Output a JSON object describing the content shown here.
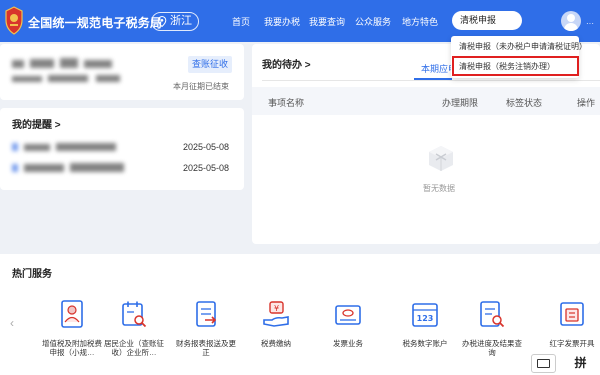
{
  "header": {
    "site_title": "全国统一规范电子税务局",
    "region": "浙江",
    "nav": [
      "首页",
      "我要办税",
      "我要查询",
      "公众服务",
      "地方特色"
    ],
    "search_value": "清税申报",
    "more": "···"
  },
  "search_dropdown": {
    "items": [
      "清税申报（未办税户申请清税证明）",
      "清税申报（税务注销办理）"
    ]
  },
  "account_card": {
    "button": "查账征收",
    "status": "本月征期已结束"
  },
  "reminders": {
    "title": "我的提醒 >",
    "items": [
      {
        "date": "2025-05-08"
      },
      {
        "date": "2025-05-08"
      }
    ]
  },
  "todo": {
    "title": "我的待办 >",
    "tab": "本期应申",
    "columns": [
      "事项名称",
      "办理期限",
      "标签状态",
      "操作"
    ],
    "empty_text": "暂无数据"
  },
  "hot_services": {
    "title": "热门服务",
    "items": [
      {
        "label": "增值税及附加税费申报（小规…",
        "icon": "person-document-icon"
      },
      {
        "label": "居民企业（查账征收）企业所…",
        "icon": "calendar-search-icon"
      },
      {
        "label": "财务报表报送及更正",
        "icon": "report-icon"
      },
      {
        "label": "税费缴纳",
        "icon": "hand-coin-icon"
      },
      {
        "label": "发票业务",
        "icon": "invoice-icon"
      },
      {
        "label": "税务数字账户",
        "icon": "number-account-icon"
      },
      {
        "label": "办税进度及结果查询",
        "icon": "progress-search-icon"
      },
      {
        "label": "红字发票开具",
        "icon": "red-invoice-icon"
      }
    ]
  },
  "ime": {
    "pinyin": "拼"
  },
  "colors": {
    "brand_blue": "#2f6ee8",
    "highlight_red": "#e02020"
  }
}
